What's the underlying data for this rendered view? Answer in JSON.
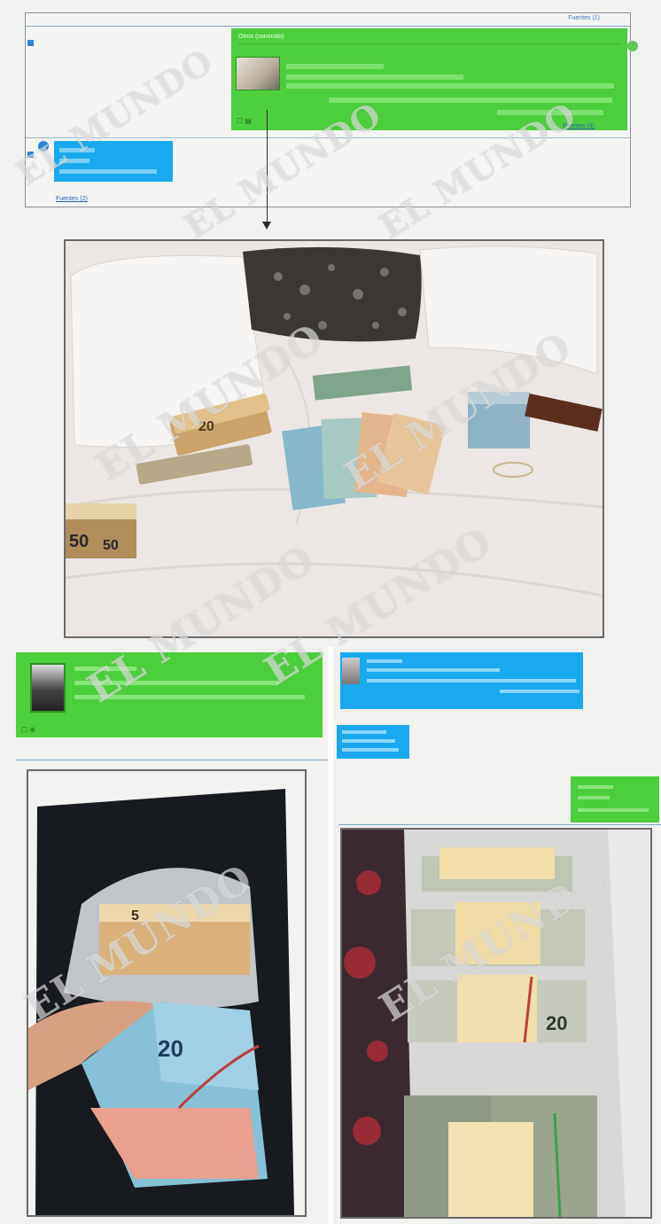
{
  "top_panel": {
    "corner_tag": "Fuentes (1)",
    "green_message": {
      "header": "Otros (conocido)",
      "sources_link": "Fuentes (3)"
    },
    "blue_message": {
      "sources_link": "Fuentes (2)"
    }
  },
  "bottom_left_panel": {},
  "bottom_right_panel": {},
  "photos": {
    "photo1_notes": [
      "20",
      "50",
      "50"
    ],
    "photo2_notes": [
      "5",
      "20"
    ],
    "photo3_notes": [
      "20"
    ]
  },
  "watermark": {
    "text": "EL MUNDO"
  },
  "colors": {
    "chat_green": "#4ccf3c",
    "chat_blue": "#1aa9ee",
    "page_bg": "#f1f1ef"
  }
}
